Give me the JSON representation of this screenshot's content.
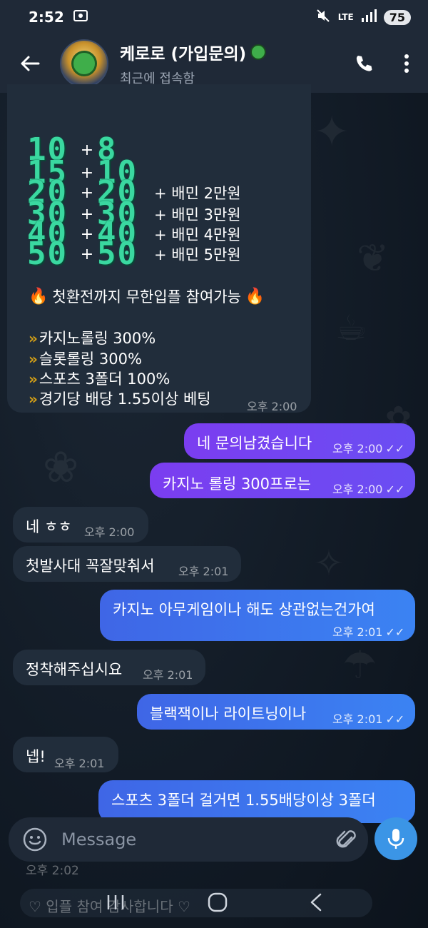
{
  "status_bar": {
    "time": "2:52",
    "network": "LTE",
    "battery": "75"
  },
  "header": {
    "title": "케로로 (가입문의)",
    "subtitle": "최근에 접속함"
  },
  "promo": {
    "rows": [
      {
        "a": "10",
        "b": "8",
        "bonus": ""
      },
      {
        "a": "15",
        "b": "10",
        "bonus": ""
      },
      {
        "a": "20",
        "b": "20",
        "bonus": "+  배민 2만원"
      },
      {
        "a": "30",
        "b": "30",
        "bonus": "+  배민 3만원"
      },
      {
        "a": "40",
        "b": "40",
        "bonus": "+ 배민 4만원"
      },
      {
        "a": "50",
        "b": "50",
        "bonus": "+  배민 5만원"
      }
    ],
    "plus": "+",
    "headline": "첫환전까지 무한입플 참여가능",
    "features": [
      "카지노롤링 300%",
      "슬롯롤링 300%",
      "스포츠 3폴더 100%",
      "경기당 배당 1.55이상 베팅"
    ],
    "time": "오후 2:00"
  },
  "messages": [
    {
      "text": "네 문의남겼습니다",
      "time": "오후 2:00"
    },
    {
      "text": "카지노 롤링 300프로는",
      "time": "오후 2:00"
    },
    {
      "text": "네 ㅎㅎ",
      "time": "오후 2:00"
    },
    {
      "text": "첫발사대 꼭잘맞춰서",
      "time": "오후 2:01"
    },
    {
      "text": "카지노 아무게임이나 해도 상관없는건가여",
      "time": "오후 2:01"
    },
    {
      "text": "정착해주십시요",
      "time": "오후 2:01"
    },
    {
      "text": "블랙잭이나 라이트닝이나",
      "time": "오후 2:01"
    },
    {
      "text": "넵!",
      "time": "오후 2:01"
    },
    {
      "text": "스포츠 3폴더 걸거면 1.55배당이상 3폴더",
      "time": ""
    }
  ],
  "input": {
    "placeholder": "Message"
  },
  "ghost": {
    "time": "오후 2:02",
    "text": "입플 참여 감사합니다"
  },
  "colors": {
    "accent": "#3b95e6",
    "outgoing_purple": "#7b3df0",
    "outgoing_blue": "#3b83f3",
    "incoming": "#212d3b"
  }
}
